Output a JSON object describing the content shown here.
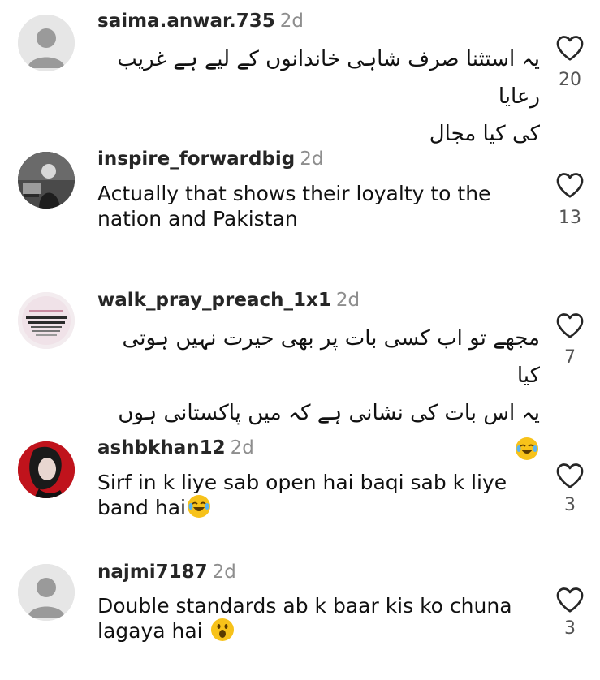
{
  "comments": [
    {
      "username": "saima.anwar.735",
      "time": "2d",
      "text_line1": "یہ استثنا صرف شاہی خاندانوں کے لیے ہے غریب رعایا",
      "text_line2": "کی کیا مجال",
      "likes": "20",
      "avatar": "default-avatar"
    },
    {
      "username": "inspire_forwardbig",
      "time": "2d",
      "text": "Actually that shows their loyalty to the nation and Pakistan",
      "likes": "13",
      "avatar": "photo-avatar"
    },
    {
      "username": "walk_pray_preach_1x1",
      "time": "2d",
      "text_line1": "مجھے تو اب کسی بات پر بھی حیرت نہیں ہوتی کیا",
      "text_line2": "یہ اس بات کی نشانی ہے کہ میں پاکستانی ہوں",
      "likes": "7",
      "avatar": "image-avatar"
    },
    {
      "username": "ashbkhan12",
      "time": "2d",
      "text_line1": "Sirf in k liye sab open hai baqi sab k liye",
      "text_line2": "band hai",
      "likes": "3",
      "avatar": "photo-avatar"
    },
    {
      "username": "najmi7187",
      "time": "2d",
      "text_line1": "Double standards  ab k baar kis ko chuna",
      "text_line2": "lagaya  hai",
      "likes": "3",
      "avatar": "default-avatar"
    }
  ],
  "icons": {
    "like": "heart-icon",
    "laugh": "laughing-emoji",
    "surprised": "surprised-emoji"
  },
  "colors": {
    "username": "#262626",
    "time": "#8e8e8e",
    "text": "#111111",
    "count": "#555555",
    "avatar_default_bg": "#e6e6e6",
    "avatar_default_fg": "#9a9a9a",
    "emoji": "#f7c21a"
  }
}
